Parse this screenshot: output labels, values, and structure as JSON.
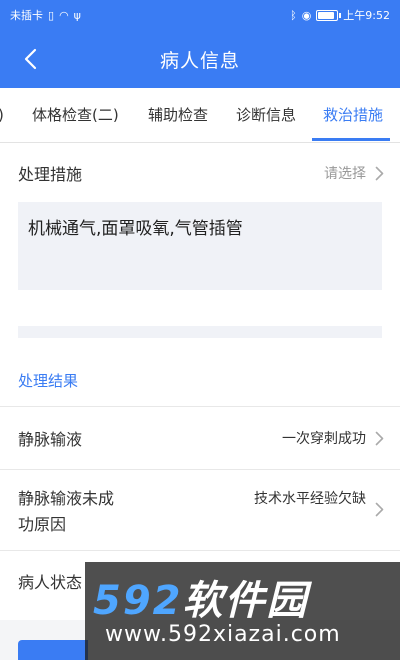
{
  "status_bar": {
    "carrier": "未插卡",
    "time": "上午9:52"
  },
  "header": {
    "title": "病人信息"
  },
  "tabs": [
    {
      "label": ")"
    },
    {
      "label": "体格检查(二)"
    },
    {
      "label": "辅助检查"
    },
    {
      "label": "诊断信息"
    },
    {
      "label": "救治措施"
    }
  ],
  "treatment": {
    "label": "处理措施",
    "placeholder": "请选择",
    "selected_text": "机械通气,面罩吸氧,气管插管"
  },
  "result_section": {
    "title": "处理结果"
  },
  "fields": [
    {
      "label": "静脉输液",
      "value": "一次穿刺成功"
    },
    {
      "label_line1": "静脉输液未成",
      "label_line2": "功原因",
      "value": "技术水平经验欠缺"
    },
    {
      "label": "病人状态"
    }
  ],
  "watermark": {
    "number": "592",
    "brand": "软件园",
    "url": "www.592xiazai.com"
  },
  "colors": {
    "primary": "#3a7cf3",
    "text": "#333333",
    "placeholder": "#999999",
    "input_bg": "#f0f2f7"
  }
}
